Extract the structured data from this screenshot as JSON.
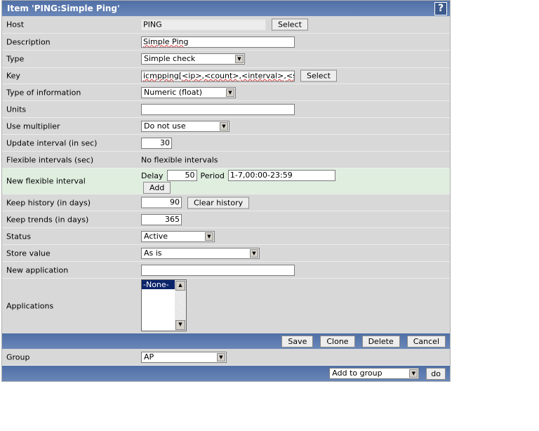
{
  "header": {
    "title": "Item 'PING:Simple Ping'",
    "help": "?"
  },
  "fields": {
    "host": {
      "label": "Host",
      "value": "PING",
      "button": "Select"
    },
    "description": {
      "label": "Description",
      "value": "Simple Ping"
    },
    "type": {
      "label": "Type",
      "value": "Simple check"
    },
    "key": {
      "label": "Key",
      "value": "icmpping[<ip>,<count>,<interval>,<size>,<timeout>]",
      "button": "Select"
    },
    "type_of_information": {
      "label": "Type of information",
      "value": "Numeric (float)"
    },
    "units": {
      "label": "Units",
      "value": ""
    },
    "use_multiplier": {
      "label": "Use multiplier",
      "value": "Do not use"
    },
    "update_interval": {
      "label": "Update interval (in sec)",
      "value": "30"
    },
    "flexible_intervals": {
      "label": "Flexible intervals (sec)",
      "value": "No flexible intervals"
    },
    "new_flexible_interval": {
      "label": "New flexible interval",
      "delay_label": "Delay",
      "delay": "50",
      "period_label": "Period",
      "period": "1-7,00:00-23:59",
      "button": "Add"
    },
    "keep_history": {
      "label": "Keep history (in days)",
      "value": "90",
      "button": "Clear history"
    },
    "keep_trends": {
      "label": "Keep trends (in days)",
      "value": "365"
    },
    "status": {
      "label": "Status",
      "value": "Active"
    },
    "store_value": {
      "label": "Store value",
      "value": "As is"
    },
    "new_application": {
      "label": "New application",
      "value": ""
    },
    "applications": {
      "label": "Applications",
      "options": [
        "-None-"
      ]
    },
    "group": {
      "label": "Group",
      "value": "AP"
    }
  },
  "actions": {
    "save": "Save",
    "clone": "Clone",
    "delete": "Delete",
    "cancel": "Cancel"
  },
  "group_action": {
    "value": "Add to group",
    "button": "do"
  }
}
